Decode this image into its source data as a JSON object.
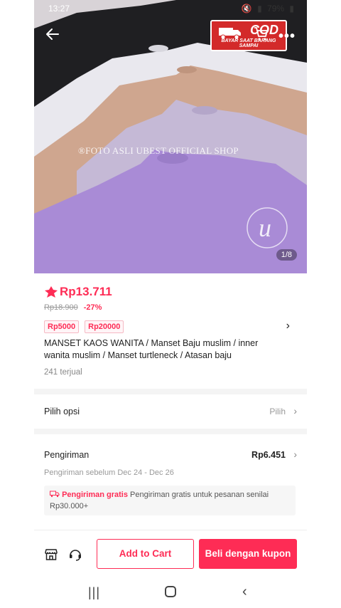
{
  "status_bar": {
    "time": "13:27",
    "battery": "79%"
  },
  "hero": {
    "cod_title": "COD",
    "cod_subtitle": "BAYAR SAAT BARANG SAMPAI",
    "more": "•••",
    "watermark": "®FOTO ASLI UBEST OFFICIAL SHOP",
    "page_indicator": "1/8",
    "shirt_colors": [
      "#1f1f22",
      "#e9e8ee",
      "#cfa68f",
      "#c5b9d6",
      "#a98bd6"
    ]
  },
  "product": {
    "price": "Rp13.711",
    "original_price": "Rp18.900",
    "discount": "-27%",
    "vouchers": [
      "Rp5000",
      "Rp20000"
    ],
    "title": "MANSET KAOS WANITA /  Manset Baju muslim / inner wanita muslim / Manset turtleneck / Atasan baju",
    "sold": "241 terjual"
  },
  "options": {
    "label": "Pilih opsi",
    "value": "Pilih"
  },
  "shipping": {
    "label": "Pengiriman",
    "price": "Rp6.451",
    "date": "Pengiriman sebelum Dec 24 - Dec 26",
    "free_tag": "Pengiriman gratis",
    "free_text": "Pengiriman gratis untuk pesanan senilai Rp30.000+"
  },
  "actions": {
    "add_to_cart": "Add to Cart",
    "buy": "Beli dengan kupon"
  },
  "colors": {
    "accent": "#fe2c55",
    "cod_red": "#d32a2a"
  }
}
